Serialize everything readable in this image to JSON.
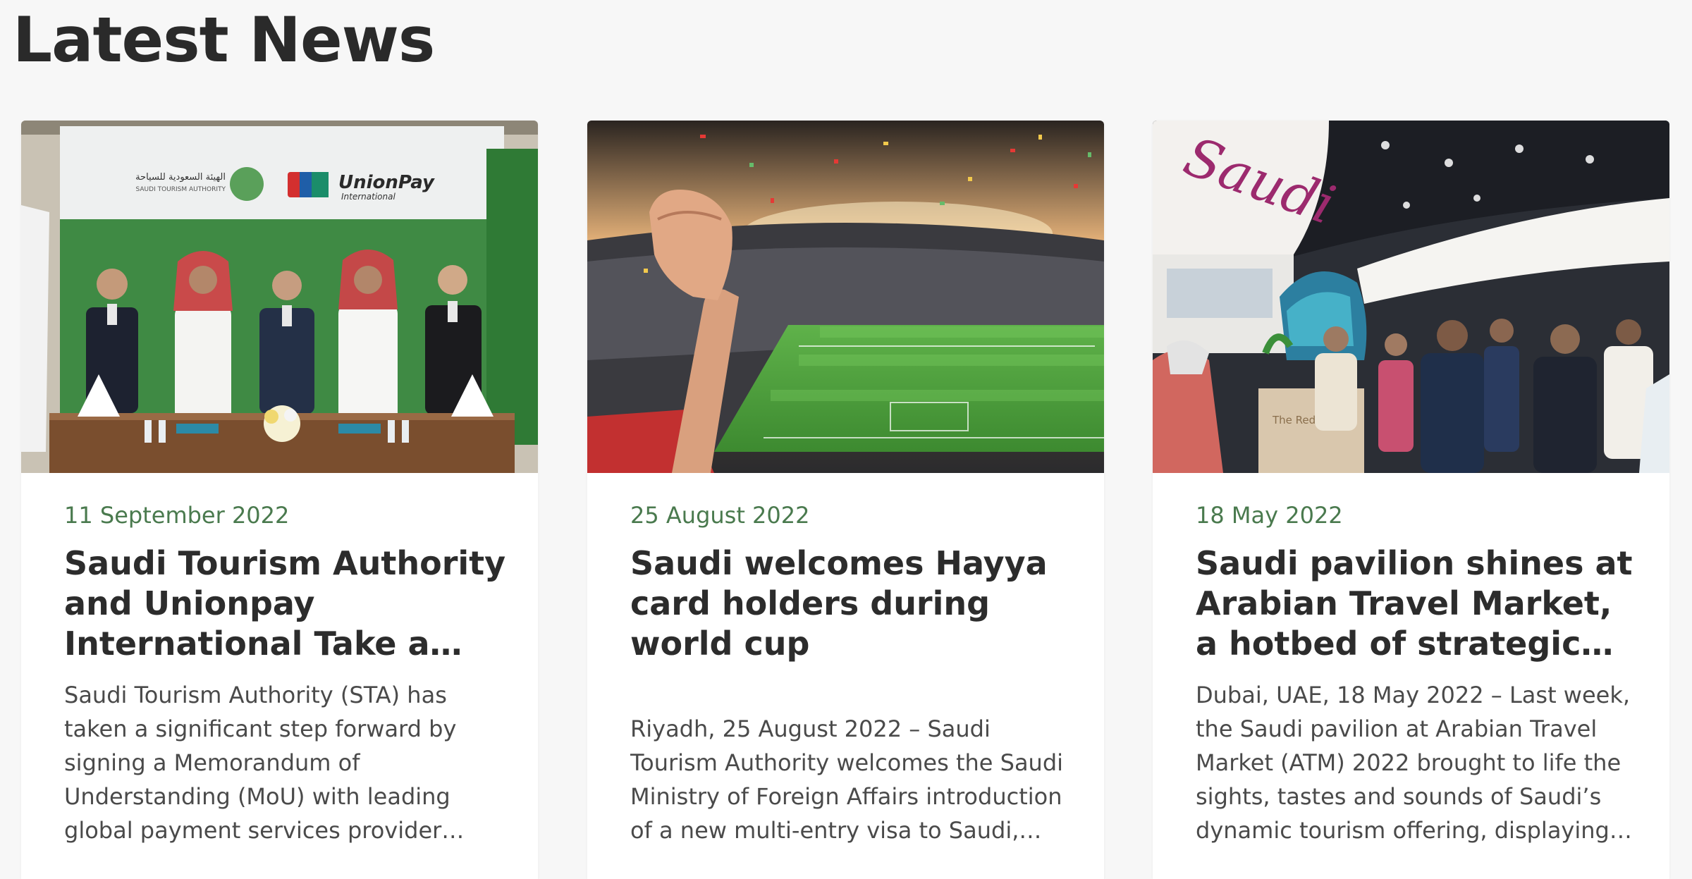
{
  "section": {
    "title": "Latest News"
  },
  "articles": [
    {
      "date": "11 September 2022",
      "title": "Saudi Tourism Authority and Unionpay International Take a…",
      "excerpt": "Saudi Tourism Authority (STA) has taken a significant step forward by signing a Memorandum of Understanding (MoU) with leading global payment services provider UnionPay International.",
      "image": {
        "banner_brand": "UnionPay",
        "banner_brand_sub": "International",
        "banner_org": "SAUDI TOURISM AUTHORITY",
        "banner_org_ar": "الهيئة السعودية للسياحة"
      }
    },
    {
      "date": "25 August 2022",
      "title": "Saudi welcomes Hayya card holders during world cup",
      "excerpt": "Riyadh, 25 August 2022 – Saudi Tourism Authority welcomes the Saudi Ministry of Foreign Affairs introduction of a new multi-entry visa to Saudi, available to…"
    },
    {
      "date": "18 May 2022",
      "title": "Saudi pavilion shines at Arabian Travel Market, a hotbed of strategic…",
      "excerpt": "Dubai, UAE, 18 May 2022 – Last week, the Saudi pavilion at Arabian Travel Market (ATM) 2022 brought to life the sights, tastes and sounds of Saudi’s dynamic tourism offering, displaying th…",
      "image": {
        "booth_brand": "Saudi",
        "booth_sign": "The Red Sea"
      }
    }
  ],
  "colors": {
    "date_green": "#4a7a4e",
    "title": "#2c2c2c",
    "excerpt": "#4a4a4a",
    "background": "#f7f7f7"
  }
}
